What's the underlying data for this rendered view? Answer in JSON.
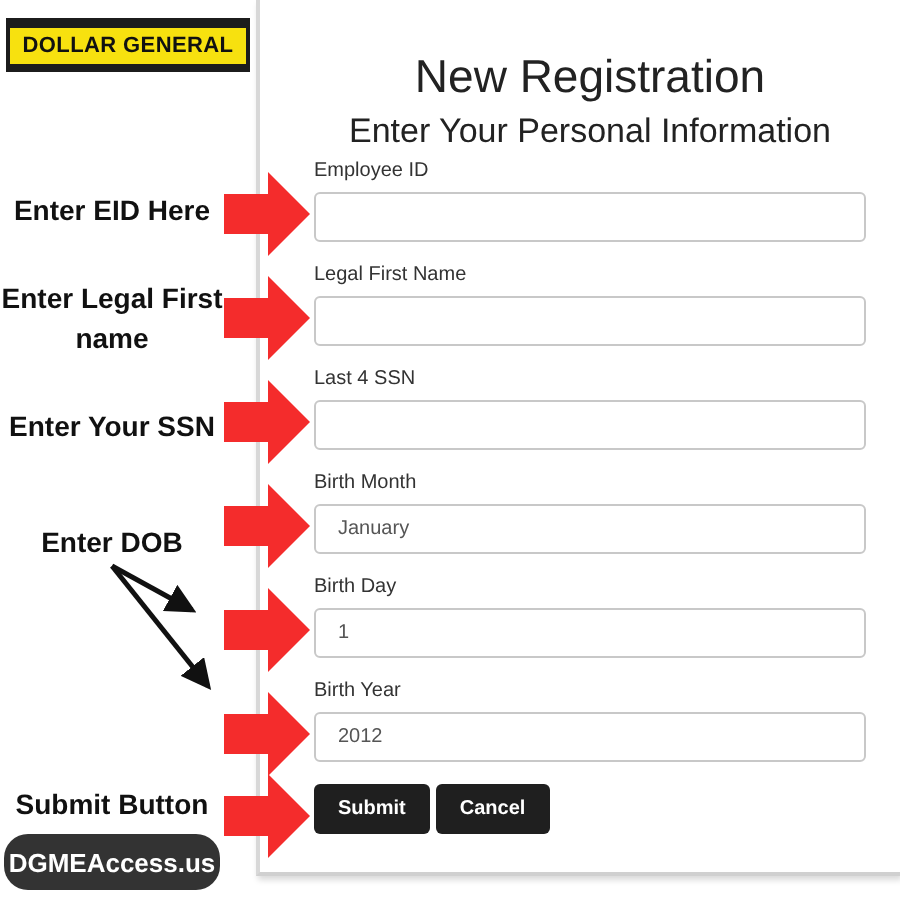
{
  "logo": {
    "text": "DOLLAR GENERAL"
  },
  "form": {
    "title": "New Registration",
    "subtitle": "Enter Your Personal Information",
    "fields": [
      {
        "label": "Employee ID"
      },
      {
        "label": "Legal First Name"
      },
      {
        "label": "Last 4 SSN"
      },
      {
        "label": "Birth Month",
        "value": "January"
      },
      {
        "label": "Birth Day",
        "value": "1"
      },
      {
        "label": "Birth Year",
        "value": "2012"
      }
    ],
    "buttons": [
      "Submit",
      "Cancel"
    ]
  },
  "callouts": [
    "Enter EID Here",
    "Enter Legal First name",
    "Enter Your SSN",
    "Enter DOB",
    "Submit Button"
  ],
  "site_badge": "DGMEAccess.us"
}
